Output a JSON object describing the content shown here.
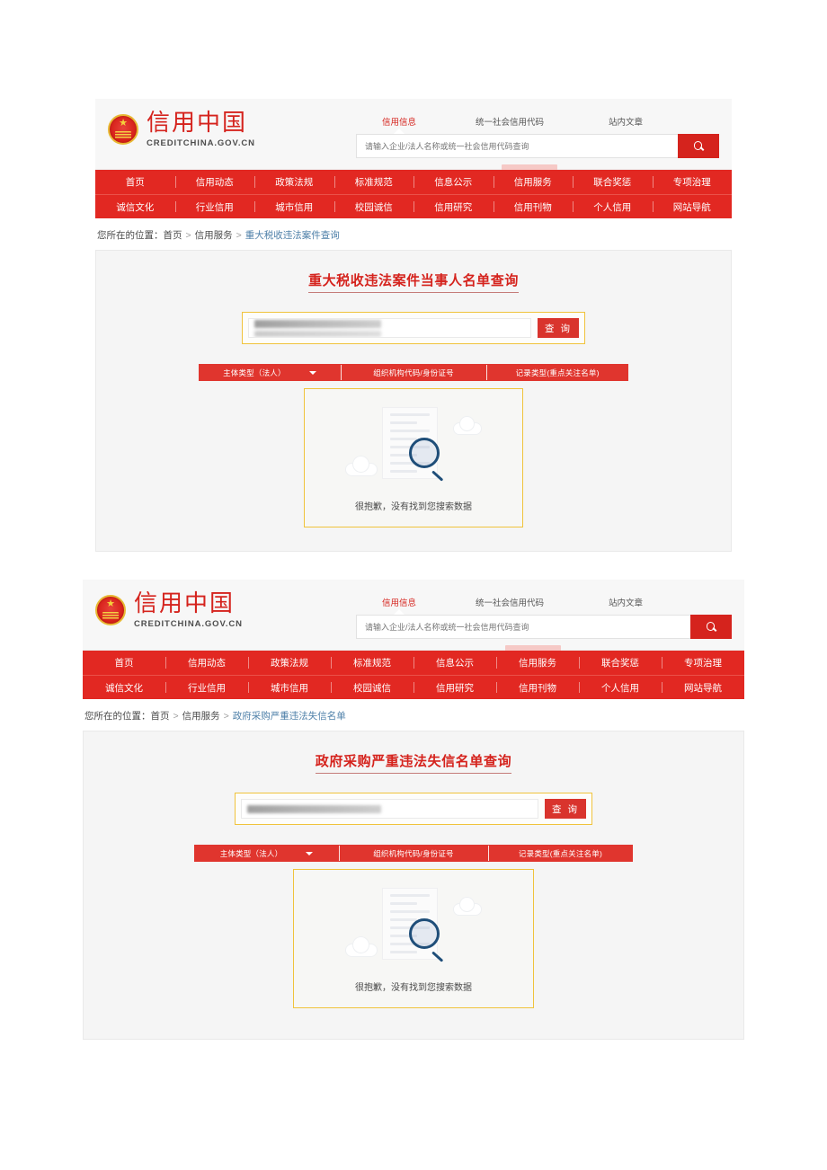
{
  "colors": {
    "brand_red": "#d5231d",
    "nav_red": "#e22822",
    "accent_yellow": "#f0c33c",
    "link_blue": "#4d7fa8",
    "panel_bg": "#f5f5f5"
  },
  "header": {
    "brand_name": "信用中国",
    "brand_domain": "CREDITCHINA.GOV.CN",
    "emblem_icon": "national-emblem-icon",
    "search": {
      "tabs": [
        "信用信息",
        "统一社会信用代码",
        "站内文章"
      ],
      "active_tab": "信用信息",
      "placeholder": "请输入企业/法人名称或统一社会信用代码查询",
      "value": "",
      "button_icon": "search-icon"
    }
  },
  "nav": {
    "active": "信用服务",
    "row1": [
      "首页",
      "信用动态",
      "政策法规",
      "标准规范",
      "信息公示",
      "信用服务",
      "联合奖惩",
      "专项治理"
    ],
    "row2": [
      "诚信文化",
      "行业信用",
      "城市信用",
      "校园诚信",
      "信用研究",
      "信用刊物",
      "个人信用",
      "网站导航"
    ]
  },
  "shot1": {
    "breadcrumb": {
      "prefix": "您所在的位置：",
      "items": [
        "首页",
        "信用服务"
      ],
      "current": "重大税收违法案件查询",
      "separator": ">"
    },
    "panel": {
      "title": "重大税收违法案件当事人名单查询",
      "query": {
        "value_redacted": true,
        "placeholder": "",
        "button_label": "查 询"
      },
      "result_headers": [
        "主体类型（法人）",
        "组织机构代码/身份证号",
        "记录类型(重点关注名单)"
      ],
      "header_dropdown_icon": "chevron-down-icon",
      "empty_state": {
        "message": "很抱歉，没有找到您搜索数据",
        "illustration": "no-results-magnifier-document-icon"
      }
    }
  },
  "shot2": {
    "breadcrumb": {
      "prefix": "您所在的位置：",
      "items": [
        "首页",
        "信用服务"
      ],
      "current": "政府采购严重违法失信名单",
      "separator": ">"
    },
    "panel": {
      "title": "政府采购严重违法失信名单查询",
      "query": {
        "value_redacted": true,
        "placeholder": "",
        "button_label": "查 询"
      },
      "result_headers": [
        "主体类型（法人）",
        "组织机构代码/身份证号",
        "记录类型(重点关注名单)"
      ],
      "header_dropdown_icon": "chevron-down-icon",
      "empty_state": {
        "message": "很抱歉，没有找到您搜索数据",
        "illustration": "no-results-magnifier-document-icon"
      }
    }
  }
}
